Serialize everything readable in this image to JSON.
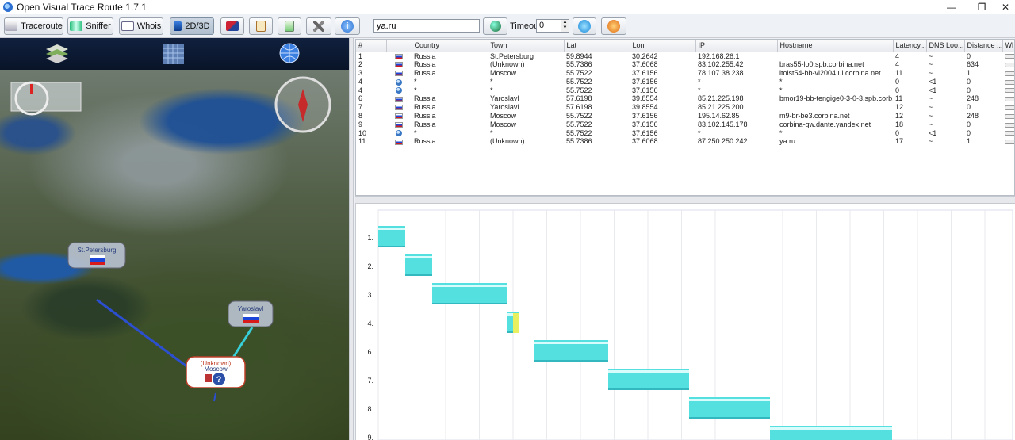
{
  "window": {
    "title": "Open Visual Trace Route 1.7.1",
    "minimize_glyph": "—",
    "maximize_glyph": "❐",
    "close_glyph": "✕"
  },
  "toolbar": {
    "traceroute_label": "Traceroute",
    "sniffer_label": "Sniffer",
    "whois_label": "Whois",
    "view_label": "2D/3D",
    "host_value": "ya.ru",
    "timeout_label": "Timeout",
    "timeout_value": "0"
  },
  "table": {
    "columns": [
      "#",
      "",
      "Country",
      "Town",
      "Lat",
      "Lon",
      "IP",
      "Hostname",
      "Latency...",
      "DNS Loo...",
      "Distance ...",
      "Wh"
    ],
    "rows": [
      {
        "n": "1",
        "flag": "ru",
        "country": "Russia",
        "town": "St.Petersburg",
        "lat": "59.8944",
        "lon": "30.2642",
        "ip": "192.168.26.1",
        "host": "",
        "latency": "4",
        "dns": "~",
        "dist": "0"
      },
      {
        "n": "2",
        "flag": "ru",
        "country": "Russia",
        "town": "(Unknown)",
        "lat": "55.7386",
        "lon": "37.6068",
        "ip": "83.102.255.42",
        "host": "bras55-lo0.spb.corbina.net",
        "latency": "4",
        "dns": "~",
        "dist": "634"
      },
      {
        "n": "3",
        "flag": "ru",
        "country": "Russia",
        "town": "Moscow",
        "lat": "55.7522",
        "lon": "37.6156",
        "ip": "78.107.38.238",
        "host": "ltolst54-bb-vl2004.ul.corbina.net",
        "latency": "11",
        "dns": "~",
        "dist": "1"
      },
      {
        "n": "4",
        "flag": "un",
        "country": "*",
        "town": "*",
        "lat": "55.7522",
        "lon": "37.6156",
        "ip": "*",
        "host": "*",
        "latency": "0",
        "dns": "<1",
        "dist": "0"
      },
      {
        "n": "4",
        "flag": "un",
        "country": "*",
        "town": "*",
        "lat": "55.7522",
        "lon": "37.6156",
        "ip": "*",
        "host": "*",
        "latency": "0",
        "dns": "<1",
        "dist": "0"
      },
      {
        "n": "6",
        "flag": "ru",
        "country": "Russia",
        "town": "Yaroslavl",
        "lat": "57.6198",
        "lon": "39.8554",
        "ip": "85.21.225.198",
        "host": "bmor19-bb-tengige0-3-0-3.spb.corb...",
        "latency": "11",
        "dns": "~",
        "dist": "248"
      },
      {
        "n": "7",
        "flag": "ru",
        "country": "Russia",
        "town": "Yaroslavl",
        "lat": "57.6198",
        "lon": "39.8554",
        "ip": "85.21.225.200",
        "host": "",
        "latency": "12",
        "dns": "~",
        "dist": "0"
      },
      {
        "n": "8",
        "flag": "ru",
        "country": "Russia",
        "town": "Moscow",
        "lat": "55.7522",
        "lon": "37.6156",
        "ip": "195.14.62.85",
        "host": "m9-br-be3.corbina.net",
        "latency": "12",
        "dns": "~",
        "dist": "248"
      },
      {
        "n": "9",
        "flag": "ru",
        "country": "Russia",
        "town": "Moscow",
        "lat": "55.7522",
        "lon": "37.6156",
        "ip": "83.102.145.178",
        "host": "corbina-gw.dante.yandex.net",
        "latency": "18",
        "dns": "~",
        "dist": "0"
      },
      {
        "n": "10",
        "flag": "un",
        "country": "*",
        "town": "*",
        "lat": "55.7522",
        "lon": "37.6156",
        "ip": "*",
        "host": "*",
        "latency": "0",
        "dns": "<1",
        "dist": "0"
      },
      {
        "n": "11",
        "flag": "ru",
        "country": "Russia",
        "town": "(Unknown)",
        "lat": "55.7386",
        "lon": "37.6068",
        "ip": "87.250.250.242",
        "host": "ya.ru",
        "latency": "17",
        "dns": "~",
        "dist": "1"
      }
    ]
  },
  "map": {
    "labels": [
      {
        "name": "map-label-st-petersburg",
        "text": "St.Petersburg"
      },
      {
        "name": "map-label-yaroslavl",
        "text": "Yaroslavl"
      },
      {
        "name": "map-label-unknown",
        "text": "(Unknown)"
      },
      {
        "name": "map-label-moscow",
        "text": "Moscow"
      }
    ],
    "unknown_glyph": "?"
  },
  "gantt": {
    "row_labels": [
      "1.",
      "2.",
      "3.",
      "4.",
      "6.",
      "7.",
      "8.",
      "9."
    ],
    "bar_color": "#55e0e0",
    "accent_color": "#e8f060"
  }
}
